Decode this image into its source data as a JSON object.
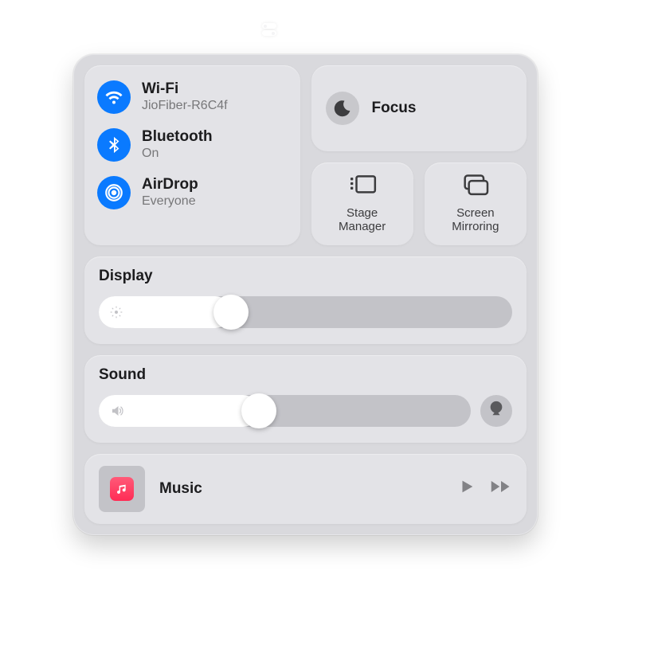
{
  "connectivity": {
    "wifi": {
      "title": "Wi-Fi",
      "subtitle": "JioFiber-R6C4f",
      "active": true
    },
    "bluetooth": {
      "title": "Bluetooth",
      "subtitle": "On",
      "active": true
    },
    "airdrop": {
      "title": "AirDrop",
      "subtitle": "Everyone",
      "active": true
    }
  },
  "focus": {
    "label": "Focus",
    "active": false
  },
  "stage_manager": {
    "label": "Stage\nManager"
  },
  "screen_mirroring": {
    "label": "Screen\nMirroring"
  },
  "display": {
    "title": "Display",
    "value_percent": 32
  },
  "sound": {
    "title": "Sound",
    "value_percent": 43
  },
  "media": {
    "app": "Music"
  },
  "colors": {
    "accent_blue": "#0a7aff",
    "panel_bg": "#d9d9dd",
    "tile_bg": "#e3e3e7",
    "track_bg": "#c3c3c8"
  }
}
